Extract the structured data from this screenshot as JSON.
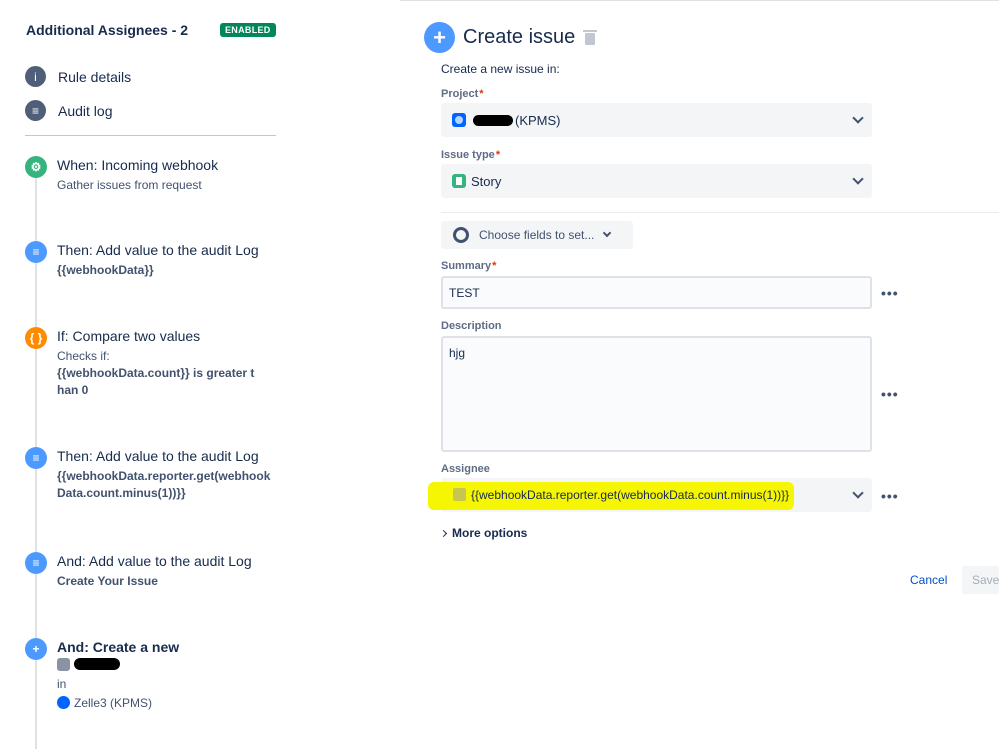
{
  "rule": {
    "title": "Additional Assignees - 2",
    "status": "ENABLED"
  },
  "nav": [
    {
      "label": "Rule details",
      "icon": "info-icon"
    },
    {
      "label": "Audit log",
      "icon": "log-icon"
    }
  ],
  "components": [
    {
      "title": "When: Incoming webhook",
      "sub": "Gather issues from request",
      "icon": "webhook-icon",
      "color": "#36b37e"
    },
    {
      "title": "Then: Add value to the audit Log",
      "sub": "{{webhookData}}",
      "icon": "log-action-icon",
      "color": "#4c9aff"
    },
    {
      "title": "If: Compare two values",
      "sub": "Checks if:",
      "sub2": "{{webhookData.count}} is greater than 0",
      "icon": "condition-icon",
      "color": "#ff8b00"
    },
    {
      "title": "Then: Add value to the audit Log",
      "sub": "{{webhookData.reporter.get(webhookData.count.minus(1))}}",
      "icon": "log-action-icon",
      "color": "#4c9aff"
    },
    {
      "title": "And: Add value to the audit Log",
      "sub": "Create Your Issue",
      "icon": "log-action-icon",
      "color": "#4c9aff"
    },
    {
      "title": "And: Create a new",
      "in": "in",
      "project": "Zelle3 (KPMS)",
      "icon": "plus-icon",
      "color": "#4c9aff"
    }
  ],
  "panel": {
    "title": "Create issue",
    "intro": "Create a new issue in:",
    "project_label": "Project",
    "project_value": "(KPMS)",
    "issue_type_label": "Issue type",
    "issue_type_value": "Story",
    "choose_fields": "Choose fields to set...",
    "summary_label": "Summary",
    "summary_value": "TEST",
    "description_label": "Description",
    "description_value": "hjg",
    "assignee_label": "Assignee",
    "assignee_value": "{{webhookData.reporter.get(webhookData.count.minus(1))}}",
    "more_options": "More options",
    "cancel": "Cancel",
    "save": "Save",
    "required_mark": "*",
    "dots": "•••"
  }
}
